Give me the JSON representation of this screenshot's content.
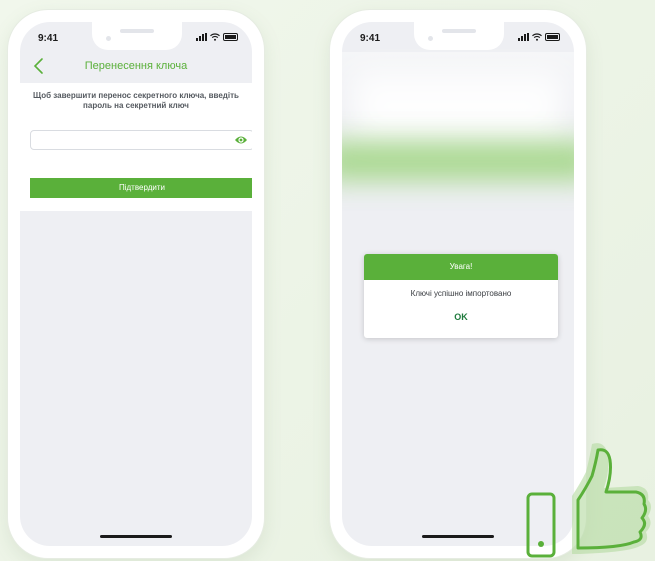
{
  "colors": {
    "accent": "#5ab03a",
    "ok_text": "#1e7a3c",
    "screen_bg": "#eeeff3"
  },
  "left_phone": {
    "status_time": "9:41",
    "header": {
      "back_icon": "chevron-left-icon",
      "title": "Перенесення ключа"
    },
    "instruction": "Щоб завершити перенос секретного ключа, введіть пароль на секретний ключ",
    "password_field": {
      "value": "",
      "placeholder": "",
      "icon": "eye-icon"
    },
    "confirm_button_label": "Підтвердити"
  },
  "right_phone": {
    "status_time": "9:41",
    "dialog": {
      "title": "Увага!",
      "message": "Ключі успішно імпортовано",
      "ok_label": "OK"
    }
  },
  "decoration": {
    "icon": "thumbs-up-icon"
  }
}
